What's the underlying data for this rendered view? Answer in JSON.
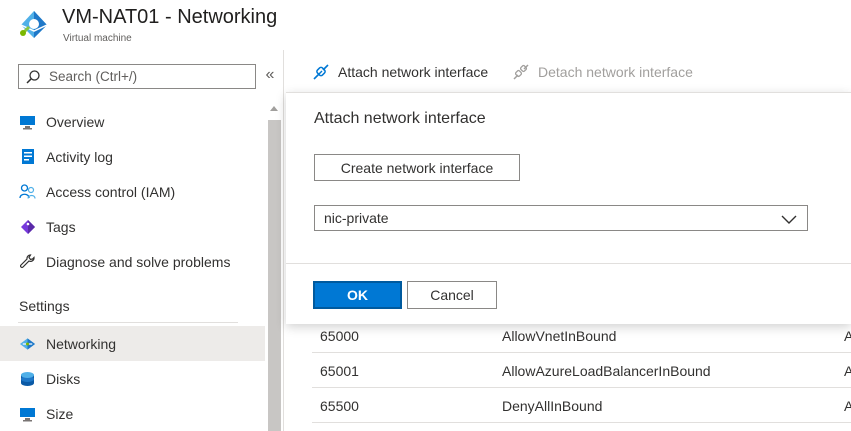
{
  "header": {
    "title": "VM-NAT01 - Networking",
    "subtitle": "Virtual machine"
  },
  "sidebar": {
    "search_placeholder": "Search (Ctrl+/)",
    "collapse_glyph": "«",
    "items": [
      {
        "label": "Overview",
        "icon": "monitor-icon"
      },
      {
        "label": "Activity log",
        "icon": "activity-log-icon"
      },
      {
        "label": "Access control (IAM)",
        "icon": "people-icon"
      },
      {
        "label": "Tags",
        "icon": "tag-icon"
      },
      {
        "label": "Diagnose and solve problems",
        "icon": "wrench-icon"
      }
    ],
    "section_label": "Settings",
    "settings_items": [
      {
        "label": "Networking",
        "icon": "networking-icon",
        "active": true
      },
      {
        "label": "Disks",
        "icon": "disks-icon"
      },
      {
        "label": "Size",
        "icon": "monitor-icon"
      }
    ]
  },
  "toolbar": {
    "attach_label": "Attach network interface",
    "detach_label": "Detach network interface"
  },
  "panel": {
    "title": "Attach network interface",
    "create_button": "Create network interface",
    "select_value": "nic-private",
    "ok_label": "OK",
    "cancel_label": "Cancel"
  },
  "rules_table": {
    "rows": [
      {
        "priority": "65000",
        "name": "AllowVnetInBound",
        "action": "A"
      },
      {
        "priority": "65001",
        "name": "AllowAzureLoadBalancerInBound",
        "action": "A"
      },
      {
        "priority": "65500",
        "name": "DenyAllInBound",
        "action": "A"
      }
    ]
  },
  "colors": {
    "accent": "#0078d4",
    "active_nav": "#edebe9",
    "border": "#8a8886"
  }
}
